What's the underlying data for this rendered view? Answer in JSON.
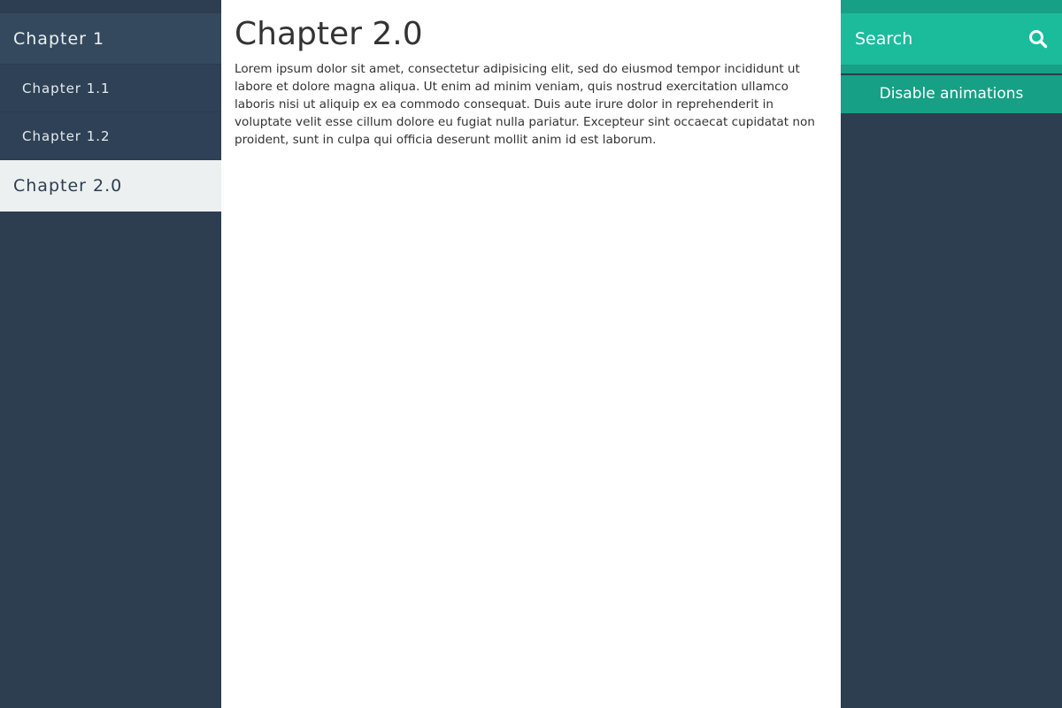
{
  "sidebar": {
    "items": [
      {
        "label": "Chapter 1",
        "level": 1,
        "active": false
      },
      {
        "label": "Chapter 1.1",
        "level": 2,
        "active": false
      },
      {
        "label": "Chapter 1.2",
        "level": 2,
        "active": false
      },
      {
        "label": "Chapter 2.0",
        "level": 1,
        "active": true
      }
    ]
  },
  "main": {
    "title": "Chapter 2.0",
    "body": "Lorem ipsum dolor sit amet, consectetur adipisicing elit, sed do eiusmod tempor incididunt ut labore et dolore magna aliqua. Ut enim ad minim veniam, quis nostrud exercitation ullamco laboris nisi ut aliquip ex ea commodo consequat. Duis aute irure dolor in reprehenderit in voluptate velit esse cillum dolore eu fugiat nulla pariatur. Excepteur sint occaecat cupidatat non proident, sunt in culpa qui officia deserunt mollit anim id est laborum."
  },
  "search": {
    "placeholder": "Search",
    "value": "",
    "icon": "search-icon"
  },
  "animations_button": {
    "label": "Disable animations"
  },
  "colors": {
    "sidebar_bg": "#2c3e50",
    "sidebar_chapter_bg": "#34495e",
    "sidebar_active_bg": "#ecf0f1",
    "accent": "#1abc9c",
    "accent_dark": "#16a085",
    "text": "#333333"
  }
}
